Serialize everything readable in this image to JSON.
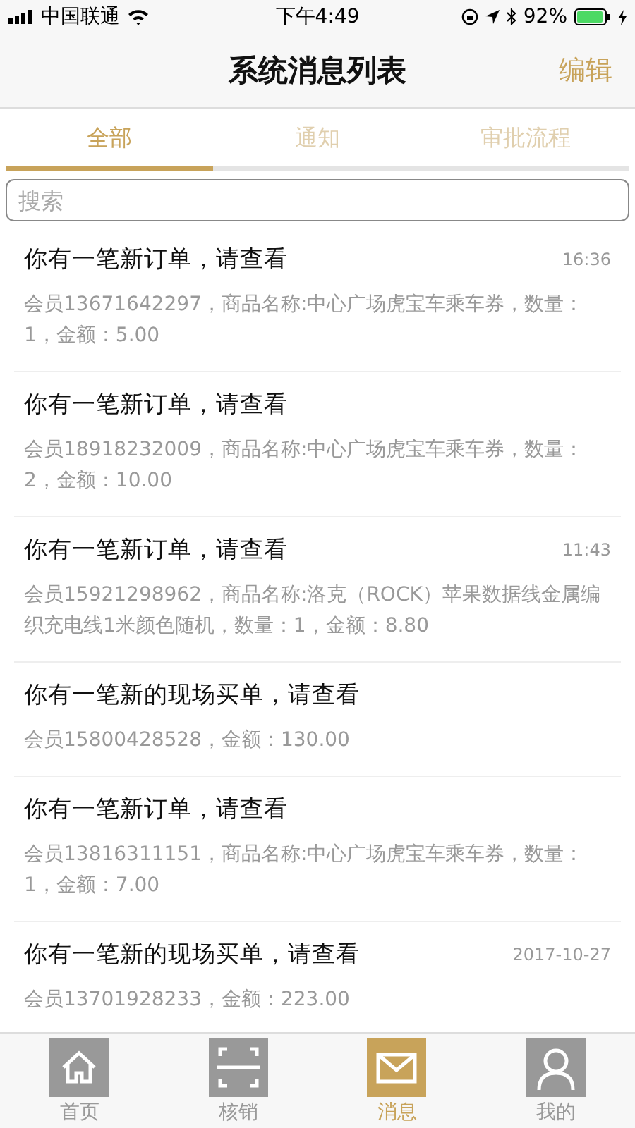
{
  "status_bar": {
    "carrier": "中国联通",
    "time": "下午4:49",
    "battery": "92%"
  },
  "nav": {
    "title": "系统消息列表",
    "action": "编辑"
  },
  "tabs": [
    {
      "label": "全部",
      "selected": true
    },
    {
      "label": "通知",
      "selected": false
    },
    {
      "label": "审批流程",
      "selected": false
    }
  ],
  "search": {
    "placeholder": "搜索"
  },
  "messages": [
    {
      "title": "你有一笔新订单，请查看",
      "time": "16:36",
      "body": "会员13671642297，商品名称:中心广场虎宝车乘车券，数量：1，金额：5.00"
    },
    {
      "title": "你有一笔新订单，请查看",
      "body": "会员18918232009，商品名称:中心广场虎宝车乘车券，数量：2，金额：10.00"
    },
    {
      "title": "你有一笔新订单，请查看",
      "time": "11:43",
      "body": "会员15921298962，商品名称:洛克（ROCK）苹果数据线金属编织充电线1米颜色随机，数量：1，金额：8.80"
    },
    {
      "title": "你有一笔新的现场买单，请查看",
      "body": "会员15800428528，金额：130.00"
    },
    {
      "title": "你有一笔新订单，请查看",
      "body": "会员13816311151，商品名称:中心广场虎宝车乘车券，数量：1，金额：7.00"
    },
    {
      "title": "你有一笔新的现场买单，请查看",
      "time": "2017-10-27",
      "body": "会员13701928233，金额：223.00"
    }
  ],
  "tab_bar": [
    {
      "kind": "home",
      "label": "首页",
      "selected": false
    },
    {
      "kind": "scan",
      "label": "核销",
      "selected": false
    },
    {
      "kind": "mail",
      "label": "消息",
      "selected": true
    },
    {
      "kind": "person",
      "label": "我的",
      "selected": false
    }
  ]
}
